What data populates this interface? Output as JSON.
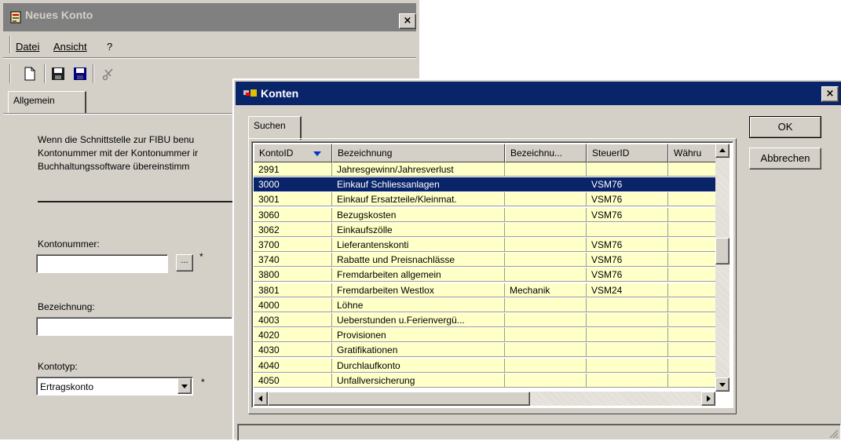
{
  "window_main": {
    "title": "Neues Konto",
    "close_glyph": "×",
    "menu": {
      "file": "Datei",
      "view": "Ansicht",
      "help": "?"
    },
    "toolbar_icons": [
      "new-document-icon",
      "save-icon",
      "save-close-icon",
      "cut-icon"
    ],
    "tab_general": "Allgemein",
    "description": "Wenn die Schnittstelle zur FIBU benu Kontonummer mit der Kontonummer ir Buchhaltungssoftware übereinstimm",
    "account_number_label": "Kontonummer:",
    "account_number_value": "",
    "browse_button": "...",
    "required_mark": "*",
    "name_label": "Bezeichnung:",
    "name_value": "",
    "account_type_label": "Kontotyp:",
    "account_type_value": "Ertragskonto"
  },
  "window_accounts": {
    "title": "Konten",
    "close_glyph": "×",
    "tab_search": "Suchen",
    "ok_label": "OK",
    "cancel_label": "Abbrechen",
    "columns": [
      "KontoID",
      "Bezeichnung",
      "Bezeichnu...",
      "SteuerID",
      "Währu"
    ],
    "sort_column": "KontoID",
    "selected_row": 1,
    "rows": [
      [
        "2991",
        "Jahresgewinn/Jahresverlust",
        "",
        "",
        ""
      ],
      [
        "3000",
        "Einkauf Schliessanlagen",
        "",
        "VSM76",
        ""
      ],
      [
        "3001",
        "Einkauf Ersatzteile/Kleinmat.",
        "",
        "VSM76",
        ""
      ],
      [
        "3060",
        "Bezugskosten",
        "",
        "VSM76",
        ""
      ],
      [
        "3062",
        "Einkaufszölle",
        "",
        "",
        ""
      ],
      [
        "3700",
        "Lieferantenskonti",
        "",
        "VSM76",
        ""
      ],
      [
        "3740",
        "Rabatte und Preisnachlässe",
        "",
        "VSM76",
        ""
      ],
      [
        "3800",
        "Fremdarbeiten allgemein",
        "",
        "VSM76",
        ""
      ],
      [
        "3801",
        "Fremdarbeiten Westlox",
        "Mechanik",
        "VSM24",
        ""
      ],
      [
        "4000",
        "Löhne",
        "",
        "",
        ""
      ],
      [
        "4003",
        "Ueberstunden u.Ferienvergü...",
        "",
        "",
        ""
      ],
      [
        "4020",
        "Provisionen",
        "",
        "",
        ""
      ],
      [
        "4030",
        "Gratifikationen",
        "",
        "",
        ""
      ],
      [
        "4040",
        "Durchlaufkonto",
        "",
        "",
        ""
      ],
      [
        "4050",
        "Unfallversicherung",
        "",
        "",
        ""
      ]
    ],
    "colors": {
      "row_bg": "#ffffc8",
      "selected_bg": "#0a246a",
      "title_active": "#0a246a",
      "title_inactive": "#808080"
    }
  }
}
